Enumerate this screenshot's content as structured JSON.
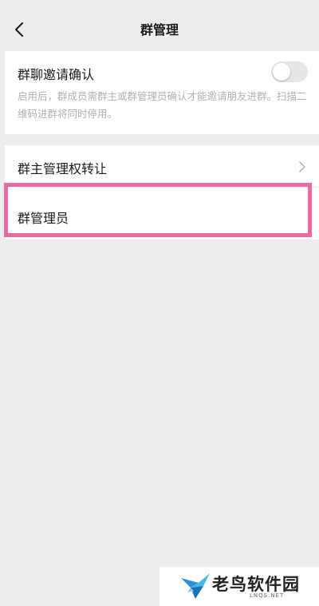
{
  "nav": {
    "title": "群管理",
    "back_icon": "chevron-left-icon"
  },
  "group_invite_confirm": {
    "title": "群聊邀请确认",
    "description": "启用后，群成员需群主或群管理员确认才能邀请朋友进群。扫描二维码进群将同时停用。",
    "toggle_on": false
  },
  "menu": {
    "transfer_label": "群主管理权转让",
    "admins_label": "群管理员",
    "chevron_icon": "chevron-right-icon"
  },
  "highlight_color": "#ec6aa2",
  "watermark": {
    "name": "老鸟软件园",
    "domain": "LNQS.NET",
    "icon": "bird-logo"
  }
}
